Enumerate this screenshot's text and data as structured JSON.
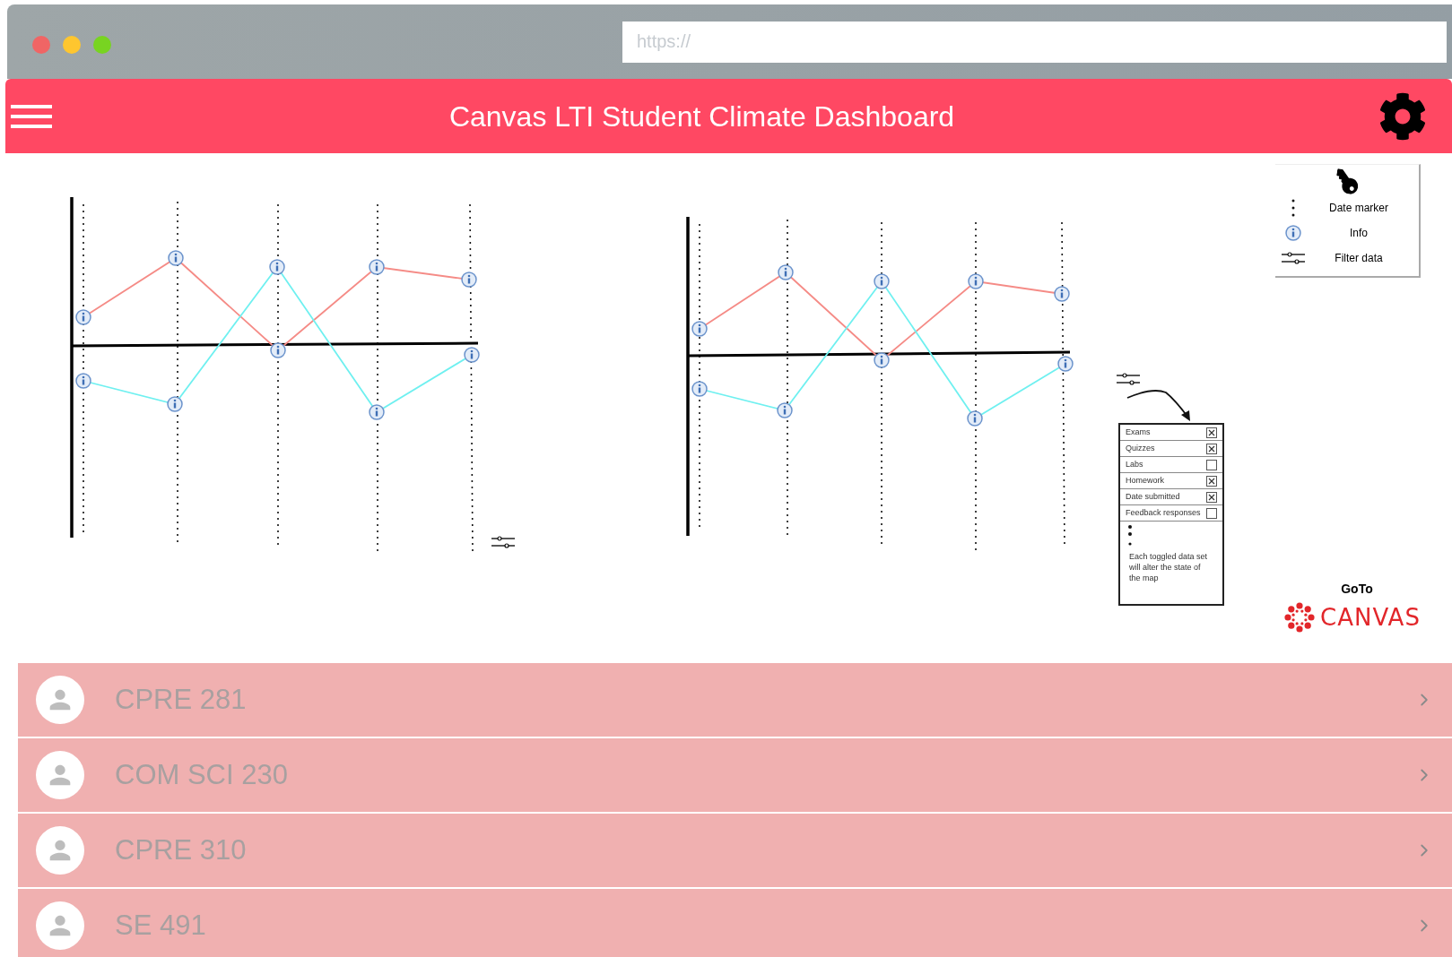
{
  "browser": {
    "url_placeholder": "https://"
  },
  "header": {
    "title": "Canvas LTI Student Climate Dashboard"
  },
  "legend": {
    "items": [
      {
        "kind": "date_marker",
        "label": "Date marker"
      },
      {
        "kind": "info",
        "label": "Info"
      },
      {
        "kind": "filter",
        "label": "Filter data"
      }
    ]
  },
  "filter_panel": {
    "options": [
      {
        "label": "Exams",
        "checked": true
      },
      {
        "label": "Quizzes",
        "checked": true
      },
      {
        "label": "Labs",
        "checked": false
      },
      {
        "label": "Homework",
        "checked": true
      },
      {
        "label": "Date submitted",
        "checked": true
      },
      {
        "label": "Feedback responses",
        "checked": false
      }
    ],
    "note": "Each toggled data set will alter the state of the map"
  },
  "canvas_link": {
    "label": "GoTo",
    "logo_text": "CANVAS"
  },
  "courses": [
    {
      "name": "CPRE 281"
    },
    {
      "name": "COM SCI 230"
    },
    {
      "name": "CPRE 310"
    },
    {
      "name": "SE 491"
    }
  ]
}
